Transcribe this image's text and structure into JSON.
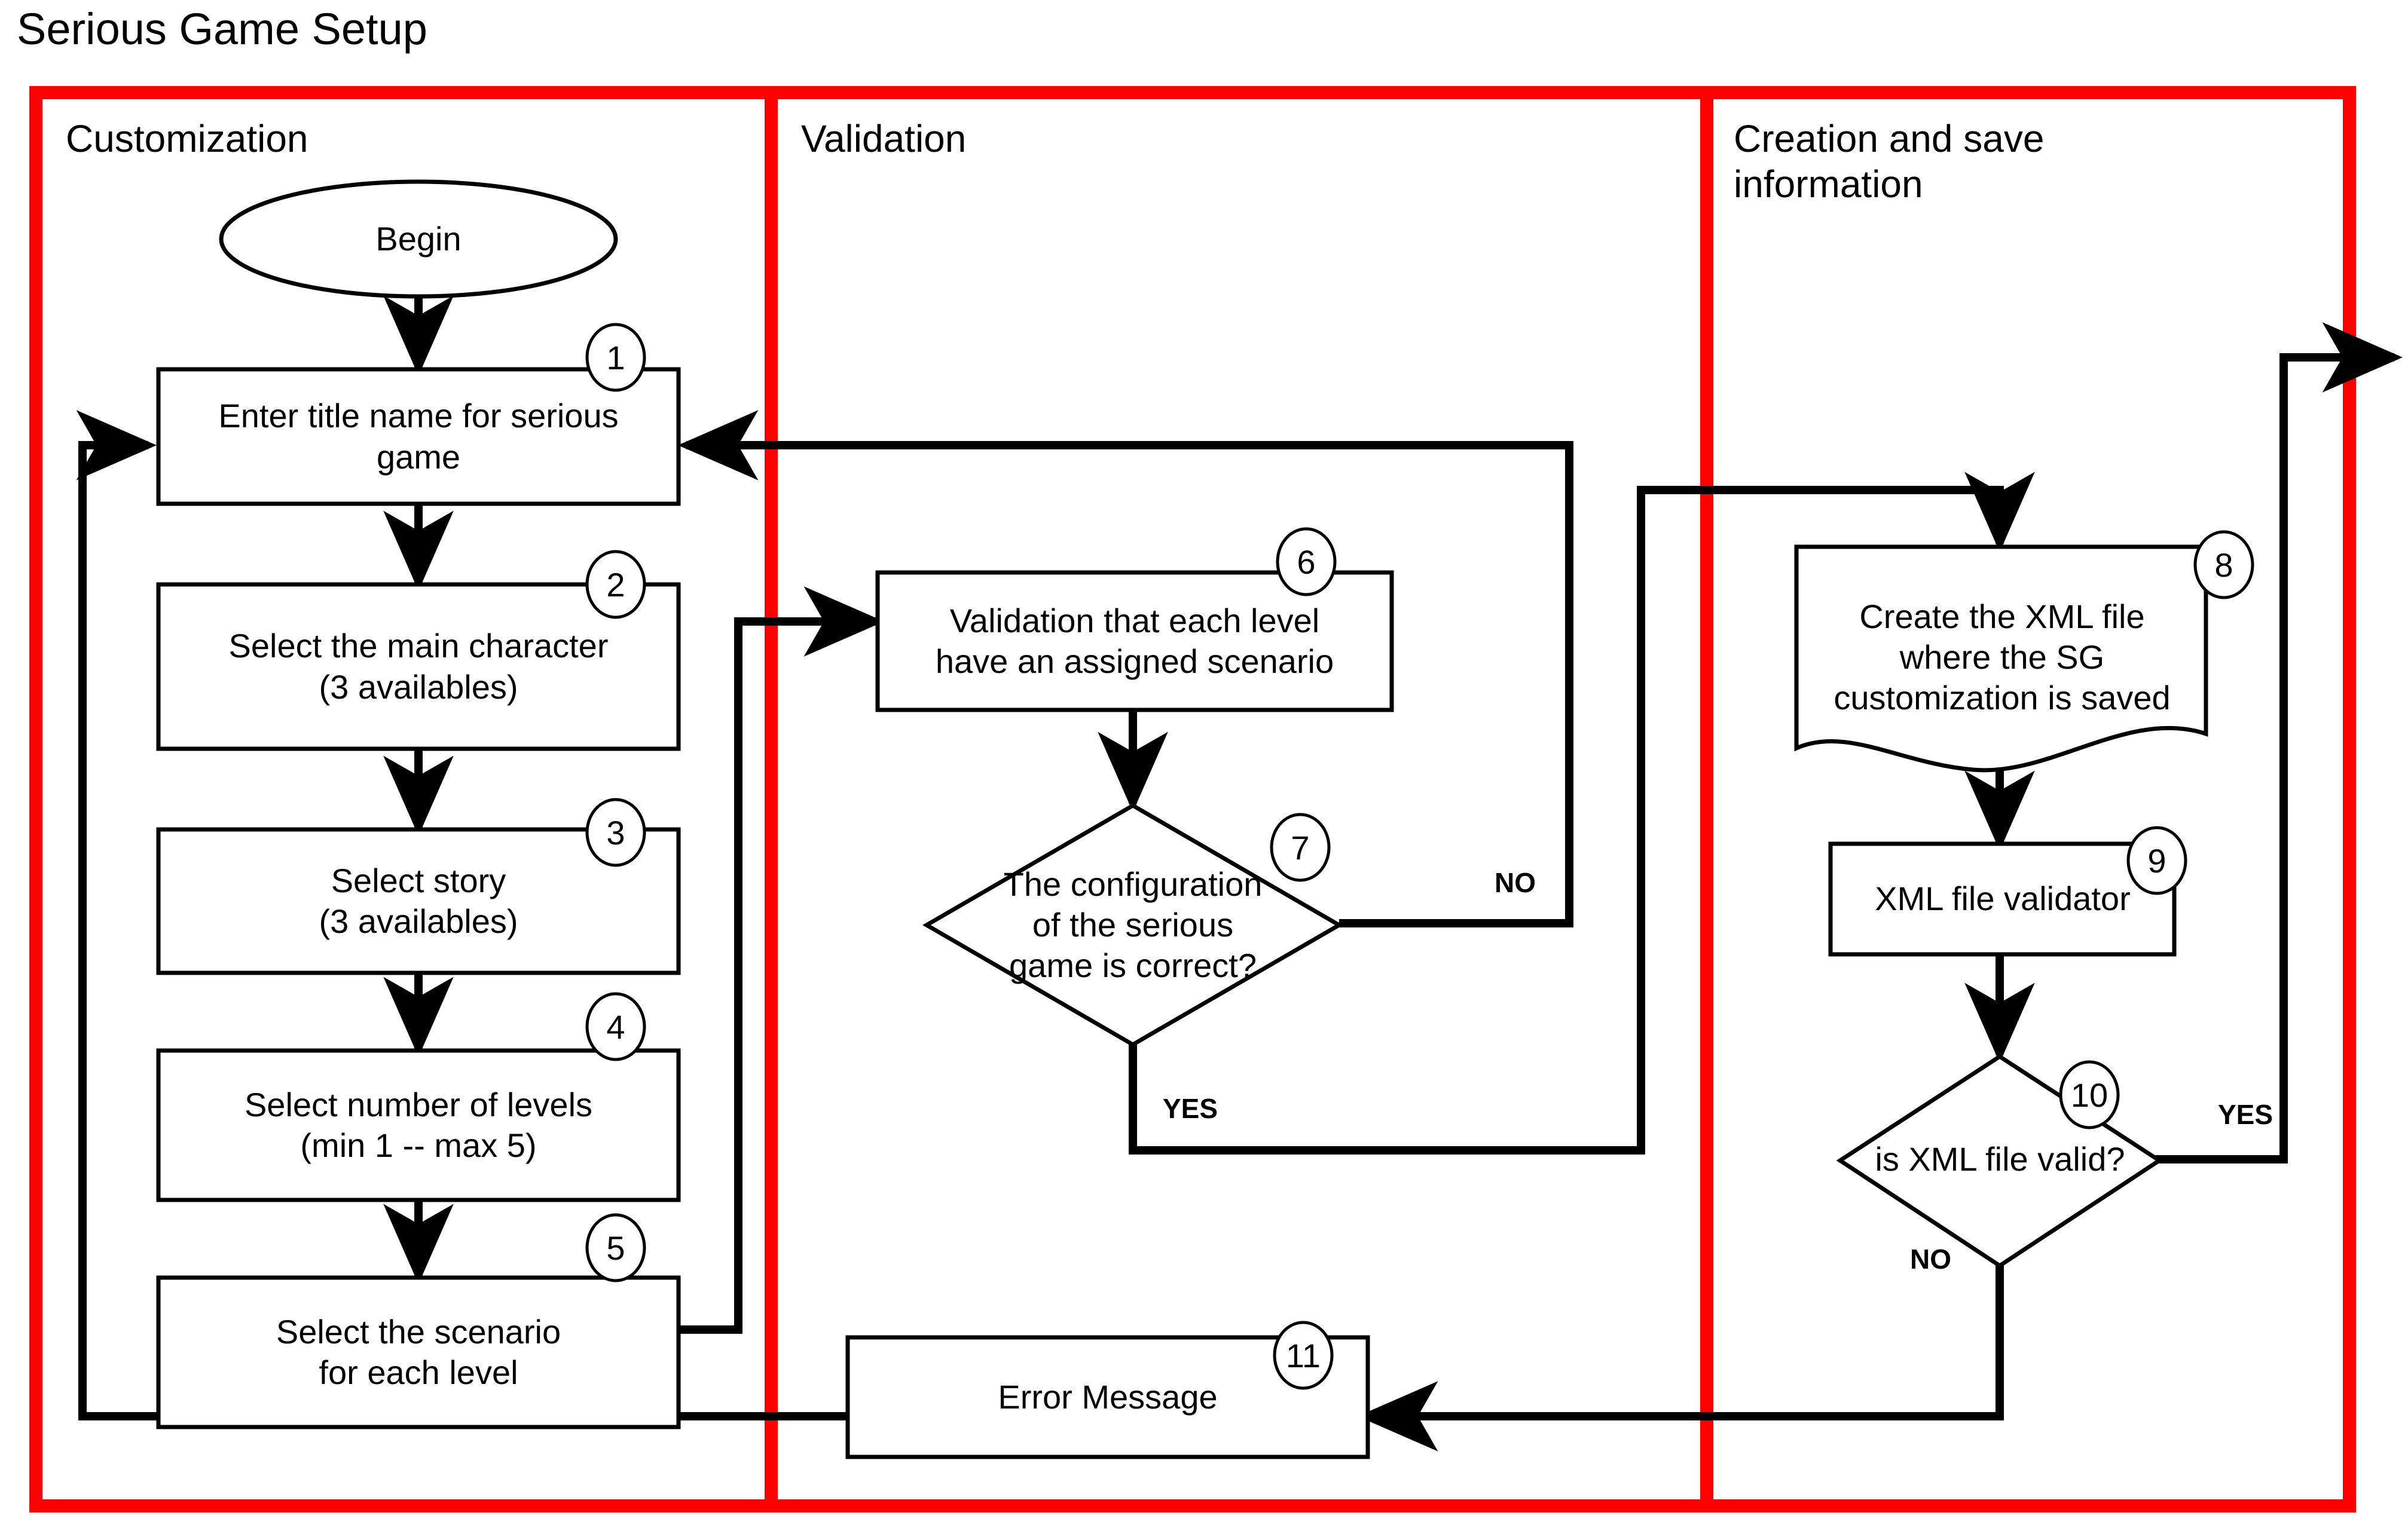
{
  "title": "Serious Game Setup",
  "swimlanes": [
    {
      "id": "customization",
      "label": "Customization"
    },
    {
      "id": "validation",
      "label": "Validation"
    },
    {
      "id": "creation",
      "label": "Creation and save\ninformation"
    }
  ],
  "colors": {
    "lane_border": "#ff0000",
    "node_stroke": "#000000",
    "node_fill": "#ffffff",
    "connector": "#000000",
    "text": "#000000"
  },
  "nodes": [
    {
      "id": "begin",
      "tag": "",
      "shape": "ellipse",
      "lane": "customization",
      "label": "Begin"
    },
    {
      "id": "n1",
      "tag": "1",
      "shape": "process",
      "lane": "customization",
      "label": "Enter title name for serious\ngame"
    },
    {
      "id": "n2",
      "tag": "2",
      "shape": "process",
      "lane": "customization",
      "label": "Select the main character\n(3 availables)"
    },
    {
      "id": "n3",
      "tag": "3",
      "shape": "process",
      "lane": "customization",
      "label": "Select story\n(3 availables)"
    },
    {
      "id": "n4",
      "tag": "4",
      "shape": "process",
      "lane": "customization",
      "label": "Select number of levels\n(min 1 -- max 5)"
    },
    {
      "id": "n5",
      "tag": "5",
      "shape": "process",
      "lane": "customization",
      "label": "Select the scenario\nfor each level"
    },
    {
      "id": "n6",
      "tag": "6",
      "shape": "process",
      "lane": "validation",
      "label": "Validation that each level\nhave an assigned scenario"
    },
    {
      "id": "n7",
      "tag": "7",
      "shape": "decision",
      "lane": "validation",
      "label": "The configuration\nof the serious\ngame is correct?"
    },
    {
      "id": "n8",
      "tag": "8",
      "shape": "document",
      "lane": "creation",
      "label": "Create the XML file\nwhere the SG\ncustomization is saved"
    },
    {
      "id": "n9",
      "tag": "9",
      "shape": "process",
      "lane": "creation",
      "label": "XML file validator"
    },
    {
      "id": "n10",
      "tag": "10",
      "shape": "decision",
      "lane": "creation",
      "label": "is XML file valid?"
    },
    {
      "id": "n11",
      "tag": "11",
      "shape": "process",
      "lane": "validation",
      "label": "Error Message"
    }
  ],
  "edge_labels": [
    {
      "id": "n7-no",
      "text": "NO",
      "from": "n7",
      "to": "n1"
    },
    {
      "id": "n7-yes",
      "text": "YES",
      "from": "n7",
      "to": "n8"
    },
    {
      "id": "n10-yes",
      "text": "YES",
      "from": "n10",
      "to": "exit"
    },
    {
      "id": "n10-no",
      "text": "NO",
      "from": "n10",
      "to": "n11"
    }
  ]
}
